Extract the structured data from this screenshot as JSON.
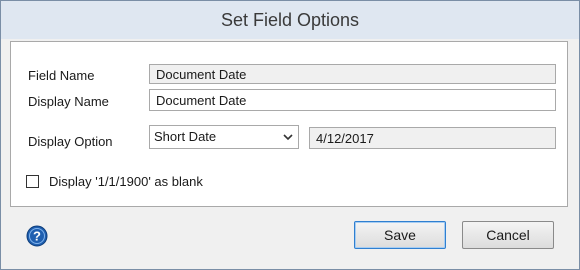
{
  "dialog": {
    "title": "Set Field Options"
  },
  "form": {
    "field_name_label": "Field Name",
    "field_name_value": "Document Date",
    "display_name_label": "Display Name",
    "display_name_value": "Document Date",
    "display_option_label": "Display Option",
    "display_option_selected": "Short Date",
    "display_option_preview": "4/12/2017",
    "blank_checkbox_label": "Display '1/1/1900' as blank",
    "blank_checkbox_checked": false
  },
  "footer": {
    "help_icon": "help-icon",
    "save_label": "Save",
    "cancel_label": "Cancel"
  },
  "colors": {
    "title_bar": "#dfe7f1",
    "help_icon": "#1f5fb0"
  }
}
